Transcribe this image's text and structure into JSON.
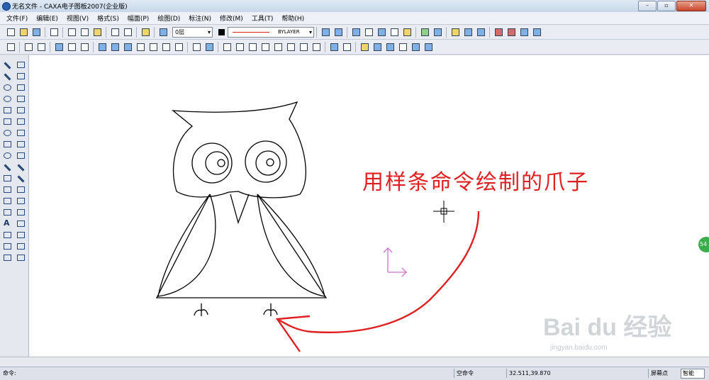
{
  "window": {
    "title": "无名文件 - CAXA电子图板2007(企业版)",
    "min_label": "–",
    "max_label": "▫",
    "close_label": "✕"
  },
  "menu": [
    "文件(F)",
    "编辑(E)",
    "视图(V)",
    "格式(S)",
    "幅面(P)",
    "绘图(D)",
    "标注(N)",
    "修改(M)",
    "工具(T)",
    "帮助(H)"
  ],
  "toolbar": {
    "layer": "0层",
    "linetype": "BYLAYER",
    "line_color": "#e02020",
    "current_color": "#000000"
  },
  "annotation": {
    "text": "用样条命令绘制的爪子",
    "color": "#e02020"
  },
  "drawing": {
    "stroke_color": "#000000",
    "ucs_color": "#d070d0"
  },
  "status": {
    "prompt_label": "命令:",
    "command": "空命令",
    "coords": "32.511,39.870",
    "snap": "屏幕点",
    "mode": "智能"
  },
  "side_badge": "54",
  "watermark": {
    "brand": "Bai du 经验",
    "url": "jingyan.baidu.com"
  }
}
